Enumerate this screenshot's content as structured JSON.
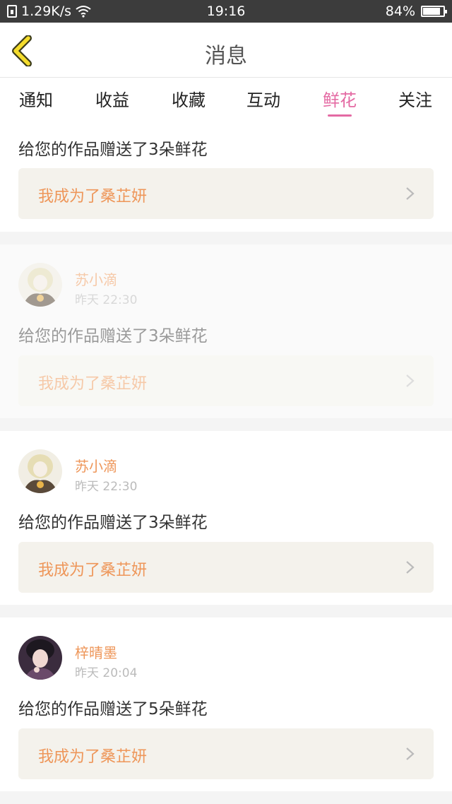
{
  "status_bar": {
    "speed": "1.29K/s",
    "time": "19:16",
    "battery": "84%",
    "battery_level": 0.84
  },
  "header": {
    "title": "消息"
  },
  "tabs": [
    {
      "label": "通知",
      "active": false
    },
    {
      "label": "收益",
      "active": false
    },
    {
      "label": "收藏",
      "active": false
    },
    {
      "label": "互动",
      "active": false
    },
    {
      "label": "鲜花",
      "active": true
    },
    {
      "label": "关注",
      "active": false
    }
  ],
  "messages": [
    {
      "text": "给您的作品赠送了3朵鲜花",
      "link": "我成为了桑芷妍"
    },
    {
      "user": "苏小滴",
      "time": "昨天 22:30",
      "text": "给您的作品赠送了3朵鲜花",
      "link": "我成为了桑芷妍"
    },
    {
      "user": "苏小滴",
      "time": "昨天 22:30",
      "text": "给您的作品赠送了3朵鲜花",
      "link": "我成为了桑芷妍"
    },
    {
      "user": "梓晴墨",
      "time": "昨天 20:04",
      "text": "给您的作品赠送了5朵鲜花",
      "link": "我成为了桑芷妍"
    }
  ],
  "colors": {
    "accent": "#e46aa3",
    "username": "#ee9659",
    "link_bg": "#f4f2ec"
  }
}
